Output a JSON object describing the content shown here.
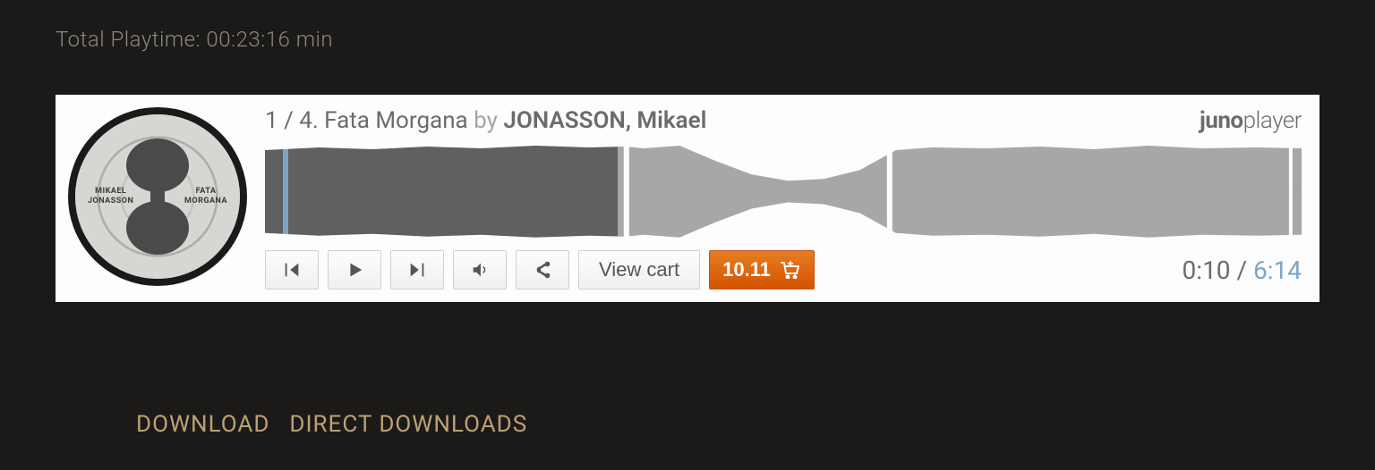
{
  "playtime_label": "Total Playtime: 00:23:16 min",
  "track": {
    "current_index": "1",
    "slash": " / ",
    "total_and_name": "4. Fata Morgana",
    "by": " by ",
    "artist": "JONASSON, Mikael"
  },
  "brand": {
    "juno": "juno",
    "player": "player"
  },
  "album": {
    "left_line1": "MIKAEL",
    "left_line2": "JONASSON",
    "right_line1": "FATA",
    "right_line2": "MORGANA"
  },
  "controls": {
    "view_cart": "View cart",
    "price": "10.11"
  },
  "time": {
    "current": "0:10",
    "sep": " / ",
    "total": "6:14"
  },
  "links": {
    "download": "DOWNLOAD",
    "direct": "DIRECT DOWNLOADS"
  },
  "waveform": {
    "progress_percent": 34,
    "marker_px": 20
  },
  "colors": {
    "accent_blue": "#7da5c5",
    "accent_orange": "#e67e22",
    "link_gold": "#baa174"
  }
}
